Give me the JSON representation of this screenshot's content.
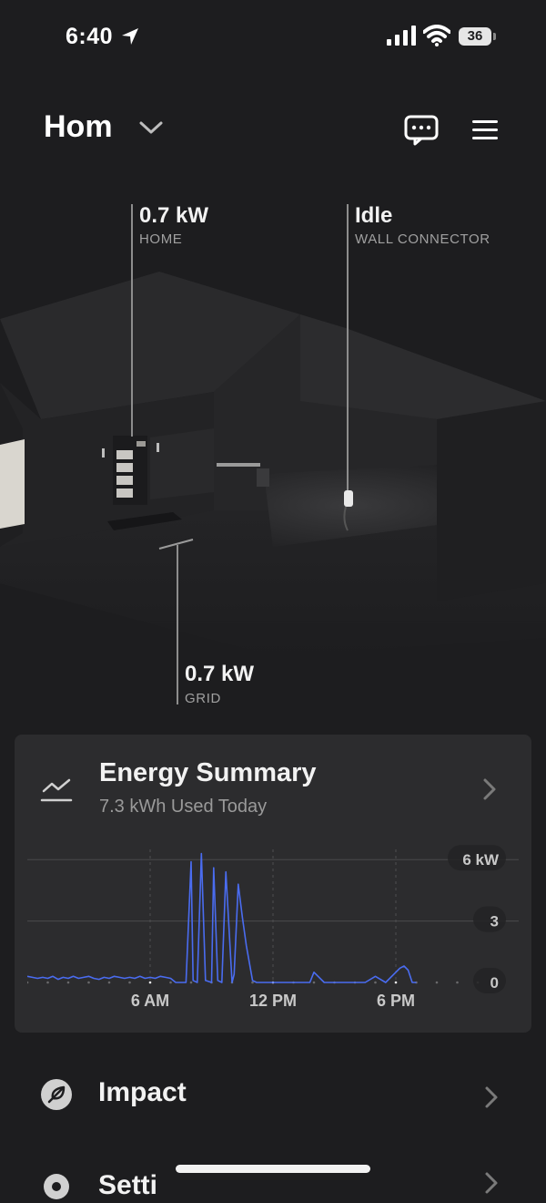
{
  "status_bar": {
    "time": "6:40",
    "battery": "36"
  },
  "header": {
    "title": "Hom"
  },
  "flows": {
    "home": {
      "value": "0.7 kW",
      "label": "HOME"
    },
    "wall_connector": {
      "value": "Idle",
      "label": "WALL CONNECTOR"
    },
    "grid": {
      "value": "0.7 kW",
      "label": "GRID"
    }
  },
  "energy_summary": {
    "title": "Energy Summary",
    "subtitle": "7.3 kWh Used Today"
  },
  "chart_data": {
    "type": "line",
    "series": [
      {
        "color": "#4a6cf0",
        "x": [
          0,
          0.25,
          0.5,
          0.75,
          1,
          1.25,
          1.5,
          1.75,
          2,
          2.25,
          2.5,
          2.75,
          3,
          3.25,
          3.5,
          3.75,
          4,
          4.25,
          4.5,
          4.75,
          5,
          5.25,
          5.5,
          5.75,
          6,
          6.25,
          6.5,
          6.75,
          7,
          7.25,
          7.5,
          7.75,
          8,
          8.1,
          8.3,
          8.5,
          8.7,
          9,
          9.1,
          9.3,
          9.5,
          9.7,
          10,
          10.1,
          10.3,
          10.5,
          10.7,
          11,
          11.2,
          11.4,
          11.6,
          11.8,
          12,
          12.1,
          12.3,
          12.5,
          12.7,
          13,
          13.2,
          13.4,
          13.6,
          13.8,
          14,
          14.5,
          15,
          15.5,
          16,
          16.5,
          17,
          17.5,
          18,
          18.2,
          18.4,
          18.6,
          18.8,
          19
        ],
        "y": [
          0.3,
          0.25,
          0.2,
          0.25,
          0.2,
          0.3,
          0.15,
          0.25,
          0.2,
          0.3,
          0.2,
          0.25,
          0.3,
          0.2,
          0.15,
          0.25,
          0.2,
          0.3,
          0.25,
          0.2,
          0.25,
          0.2,
          0.3,
          0.2,
          0.25,
          0.2,
          0.3,
          0.25,
          0.2,
          0.0,
          0.0,
          0.0,
          5.9,
          0.1,
          0.0,
          6.3,
          0.1,
          0.0,
          5.6,
          0.1,
          0.0,
          5.4,
          0.0,
          0.4,
          4.8,
          3.2,
          1.8,
          0.1,
          0.0,
          0.0,
          0.0,
          0.0,
          0.0,
          0.0,
          0.0,
          0.0,
          0.0,
          0.0,
          0.0,
          0.0,
          0.0,
          0.0,
          0.5,
          0.0,
          0.0,
          0.0,
          0.0,
          0.0,
          0.3,
          0.0,
          0.5,
          0.7,
          0.8,
          0.6,
          0.0,
          0.0
        ]
      }
    ],
    "x_ticks": [
      "6 AM",
      "12 PM",
      "6 PM"
    ],
    "y_ticks": [
      "6 kW",
      "3",
      "0"
    ],
    "ylim": [
      0,
      6.5
    ],
    "xlim": [
      0,
      24
    ],
    "grid": true
  },
  "rows": {
    "impact": {
      "label": "Impact"
    },
    "settings": {
      "label": "Setti"
    }
  },
  "icons": {
    "location": "location-arrow-icon",
    "signal": "cellular-signal-icon",
    "wifi": "wifi-icon",
    "chat": "chat-bubble-icon",
    "menu": "hamburger-menu-icon",
    "trend": "trend-line-icon",
    "leaf": "leaf-icon",
    "gear": "gear-icon"
  },
  "colors": {
    "background": "#1d1d1f",
    "card": "#2c2c2e",
    "accent": "#4a6cf0"
  }
}
